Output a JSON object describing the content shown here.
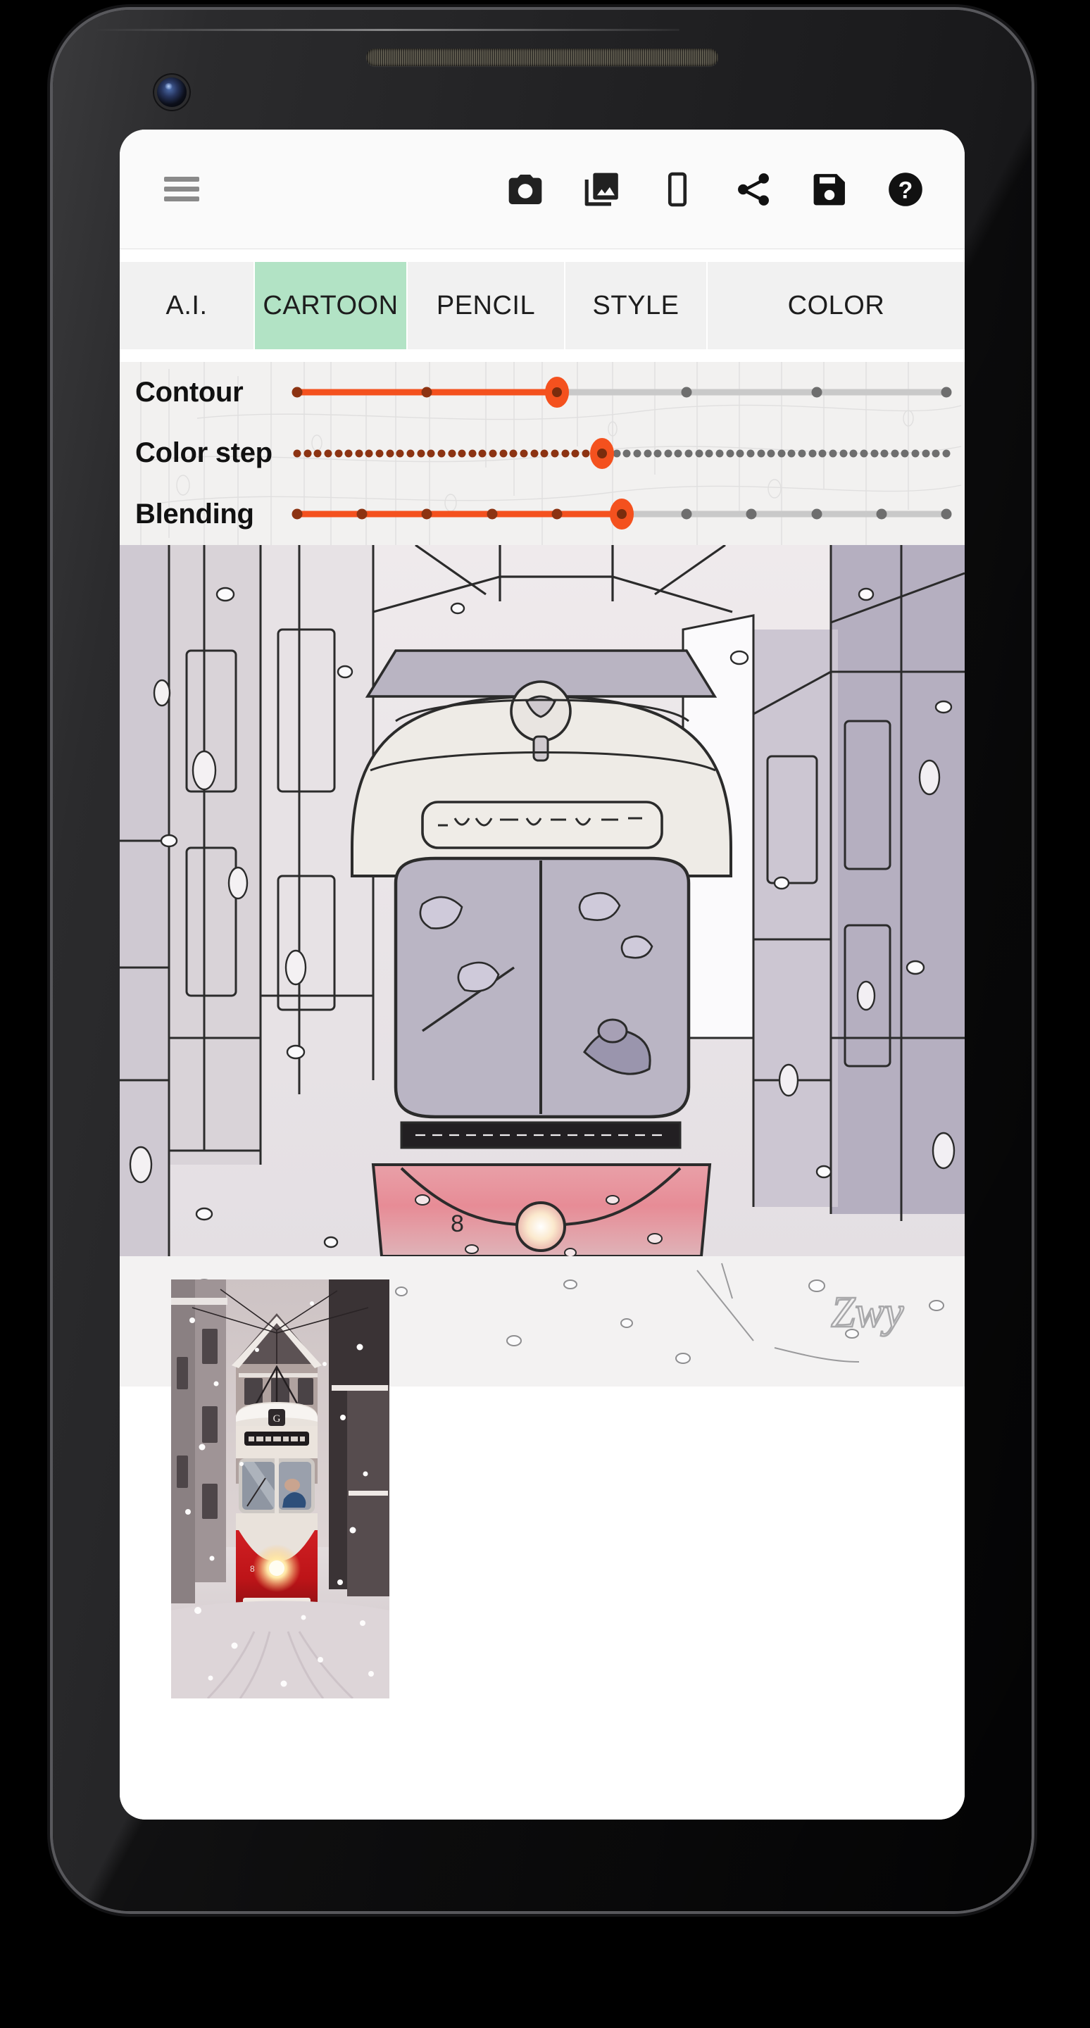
{
  "device": {
    "name": "android-phone-mockup",
    "parts": [
      "top-speaker-grille",
      "front-camera",
      "bottom-speaker-grille",
      "power-button",
      "volume-button"
    ]
  },
  "app": {
    "toolbar": {
      "menu": {
        "label": "Menu",
        "icon": "hamburger-menu-icon"
      },
      "actions": [
        {
          "id": "camera",
          "label": "Camera",
          "icon": "camera-icon"
        },
        {
          "id": "gallery",
          "label": "Gallery",
          "icon": "gallery-icon"
        },
        {
          "id": "aspect",
          "label": "Aspect ratio",
          "icon": "crop-frame-icon"
        },
        {
          "id": "share",
          "label": "Share",
          "icon": "share-icon"
        },
        {
          "id": "save",
          "label": "Save",
          "icon": "save-floppy-icon"
        },
        {
          "id": "help",
          "label": "Help",
          "icon": "help-question-icon"
        }
      ]
    },
    "tabs": {
      "active": "CARTOON",
      "active_color": "#b2e3c5",
      "inactive_color": "#f1f1f1",
      "items": [
        {
          "id": "ai",
          "label": "A.I."
        },
        {
          "id": "cartoon",
          "label": "CARTOON"
        },
        {
          "id": "pencil",
          "label": "PENCIL"
        },
        {
          "id": "style",
          "label": "STYLE"
        },
        {
          "id": "color",
          "label": "COLOR"
        }
      ]
    },
    "sliders": {
      "accent_color": "#f4511e",
      "track_color": "#c9c9c9",
      "items": [
        {
          "id": "contour",
          "label": "Contour",
          "ticks": 5,
          "value_index": 2,
          "value_percent": 50
        },
        {
          "id": "color_step",
          "label": "Color step",
          "ticks": 64,
          "value_index": 30,
          "value_percent": 47
        },
        {
          "id": "blending",
          "label": "Blending",
          "ticks": 11,
          "value_index": 5,
          "value_percent": 50
        }
      ]
    },
    "preview": {
      "name": "cartoon-filtered-preview",
      "description": "Cartoon-filtered photo of a red and cream tram in heavy snowfall on a narrow street"
    },
    "thumbnail": {
      "name": "original-photo-thumbnail",
      "description": "Original unfiltered photo of a red tram in the snow"
    },
    "watermark": {
      "text": "Zwy"
    }
  }
}
